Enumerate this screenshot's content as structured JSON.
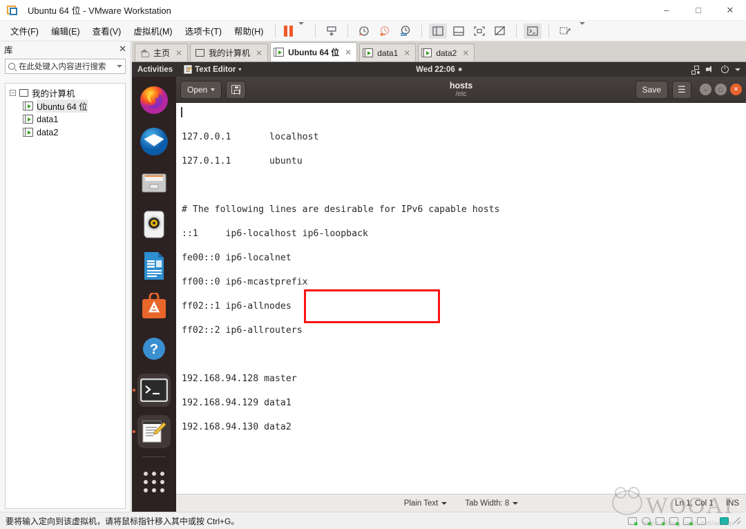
{
  "window": {
    "title": "Ubuntu 64 位 - VMware Workstation",
    "app_icon": "vmware-icon",
    "controls": {
      "minimize": "–",
      "maximize": "□",
      "close": "✕"
    }
  },
  "menubar": {
    "items": [
      {
        "label": "文件(F)",
        "name": "menu-file"
      },
      {
        "label": "编辑(E)",
        "name": "menu-edit"
      },
      {
        "label": "查看(V)",
        "name": "menu-view"
      },
      {
        "label": "虚拟机(M)",
        "name": "menu-vm"
      },
      {
        "label": "选项卡(T)",
        "name": "menu-tabs"
      },
      {
        "label": "帮助(H)",
        "name": "menu-help"
      }
    ],
    "toolbar": [
      {
        "name": "pause-button",
        "glyph": "⏸"
      },
      {
        "name": "pause-dropdown",
        "glyph": "▾"
      },
      {
        "name": "send-key-button",
        "glyph": "⎙"
      },
      {
        "name": "snapshot-take-button",
        "glyph": "⏱"
      },
      {
        "name": "snapshot-revert-button",
        "glyph": "⏲"
      },
      {
        "name": "snapshot-manager-button",
        "glyph": "⏳"
      },
      {
        "name": "show-library-button",
        "glyph": "▥"
      },
      {
        "name": "show-thumbnail-bar-button",
        "glyph": "▤"
      },
      {
        "name": "fullscreen-button",
        "glyph": "⛶"
      },
      {
        "name": "unity-mode-button",
        "glyph": "⧉"
      },
      {
        "name": "console-button",
        "glyph": "▶_"
      },
      {
        "name": "send-ctrl-alt-del-button",
        "glyph": "⌧"
      },
      {
        "name": "toolbar-overflow-caret",
        "glyph": "▾"
      }
    ]
  },
  "library": {
    "title": "库",
    "close_label": "✕",
    "search": {
      "placeholder": "在此处键入内容进行搜索",
      "value": "",
      "icon": "search-icon",
      "dropdown": "▾"
    },
    "tree": {
      "root": {
        "label": "我的计算机",
        "expander": "−",
        "icon": "computer-icon"
      },
      "children": [
        {
          "label": "Ubuntu 64 位",
          "icon": "vm-icon",
          "selected": true
        },
        {
          "label": "data1",
          "icon": "vm-icon",
          "selected": false
        },
        {
          "label": "data2",
          "icon": "vm-icon",
          "selected": false
        }
      ]
    }
  },
  "tabs": [
    {
      "label": "主页",
      "icon": "home-icon",
      "active": false,
      "close": "✕"
    },
    {
      "label": "我的计算机",
      "icon": "computer-icon",
      "active": false,
      "close": "✕"
    },
    {
      "label": "Ubuntu 64 位",
      "icon": "vm-icon",
      "active": true,
      "close": "✕"
    },
    {
      "label": "data1",
      "icon": "vm-icon",
      "active": false,
      "close": "✕"
    },
    {
      "label": "data2",
      "icon": "vm-icon",
      "active": false,
      "close": "✕"
    }
  ],
  "guest": {
    "topbar": {
      "activities": "Activities",
      "app_name": "Text Editor",
      "app_caret": "▾",
      "clock": "Wed 22:06",
      "clock_dot": "●",
      "tray": [
        {
          "name": "network-icon"
        },
        {
          "name": "volume-icon"
        },
        {
          "name": "power-icon"
        },
        {
          "name": "chevron-down-icon"
        }
      ]
    },
    "dock": [
      {
        "name": "firefox-icon",
        "label": "Firefox",
        "running": false
      },
      {
        "name": "thunderbird-icon",
        "label": "Thunderbird Mail",
        "running": false
      },
      {
        "name": "files-icon",
        "label": "Files",
        "running": false
      },
      {
        "name": "rhythmbox-icon",
        "label": "Rhythmbox",
        "running": false
      },
      {
        "name": "libreoffice-writer-icon",
        "label": "LibreOffice Writer",
        "running": false
      },
      {
        "name": "ubuntu-software-icon",
        "label": "Ubuntu Software",
        "running": false
      },
      {
        "name": "help-icon",
        "label": "Help",
        "running": false
      },
      {
        "name": "terminal-icon",
        "label": "Terminal",
        "running": true
      },
      {
        "name": "text-editor-icon",
        "label": "Text Editor",
        "running": true
      },
      {
        "name": "show-applications-icon",
        "label": "Show Applications",
        "running": false
      }
    ],
    "gedit": {
      "open_label": "Open",
      "open_caret": "▾",
      "save_as_icon": "save-as-icon",
      "title": "hosts",
      "subtitle": "/etc",
      "save_label": "Save",
      "menu_glyph": "☰",
      "window_buttons": {
        "minimize": "–",
        "maximize": "□",
        "close": "✕"
      },
      "content_lines": [
        "127.0.0.1\tlocalhost",
        "127.0.1.1\tubuntu",
        "",
        "# The following lines are desirable for IPv6 capable hosts",
        "::1     ip6-localhost ip6-loopback",
        "fe00::0 ip6-localnet",
        "ff00::0 ip6-mcastprefix",
        "ff02::1 ip6-allnodes",
        "ff02::2 ip6-allrouters",
        ""
      ],
      "highlighted_lines": [
        "192.168.94.128 master",
        "192.168.94.129 data1",
        "192.168.94.130 data2"
      ],
      "annotation": {
        "name": "red-highlight-box",
        "color": "#fb1414"
      },
      "statusbar": {
        "language": "Plain Text",
        "language_caret": "▾",
        "tab_width": "Tab Width: 8",
        "tab_width_caret": "▾",
        "position": "Ln 1, Col 1",
        "insert_mode": "INS"
      }
    }
  },
  "status_bar": {
    "hint": "要将输入定向到该虚拟机，请将鼠标指针移入其中或按 Ctrl+G。",
    "icons": [
      {
        "name": "hard-disk-status-icon"
      },
      {
        "name": "cd-dvd-status-icon"
      },
      {
        "name": "floppy-status-icon"
      },
      {
        "name": "network-adapter-status-icon"
      },
      {
        "name": "network-adapter-2-status-icon"
      },
      {
        "name": "printer-status-icon"
      },
      {
        "name": "usb-status-icon"
      },
      {
        "name": "display-status-icon"
      },
      {
        "name": "resize-grip-icon"
      }
    ]
  },
  "watermark": {
    "text": "WOOAI",
    "sub": "https://blog.csdn.net/wooai"
  },
  "colors": {
    "accent_orange": "#f05a28",
    "ubuntu_bar": "#353130",
    "dock_bg": "#2d2222",
    "annotation_red": "#fb1414",
    "gedit_header": "#403b39"
  }
}
